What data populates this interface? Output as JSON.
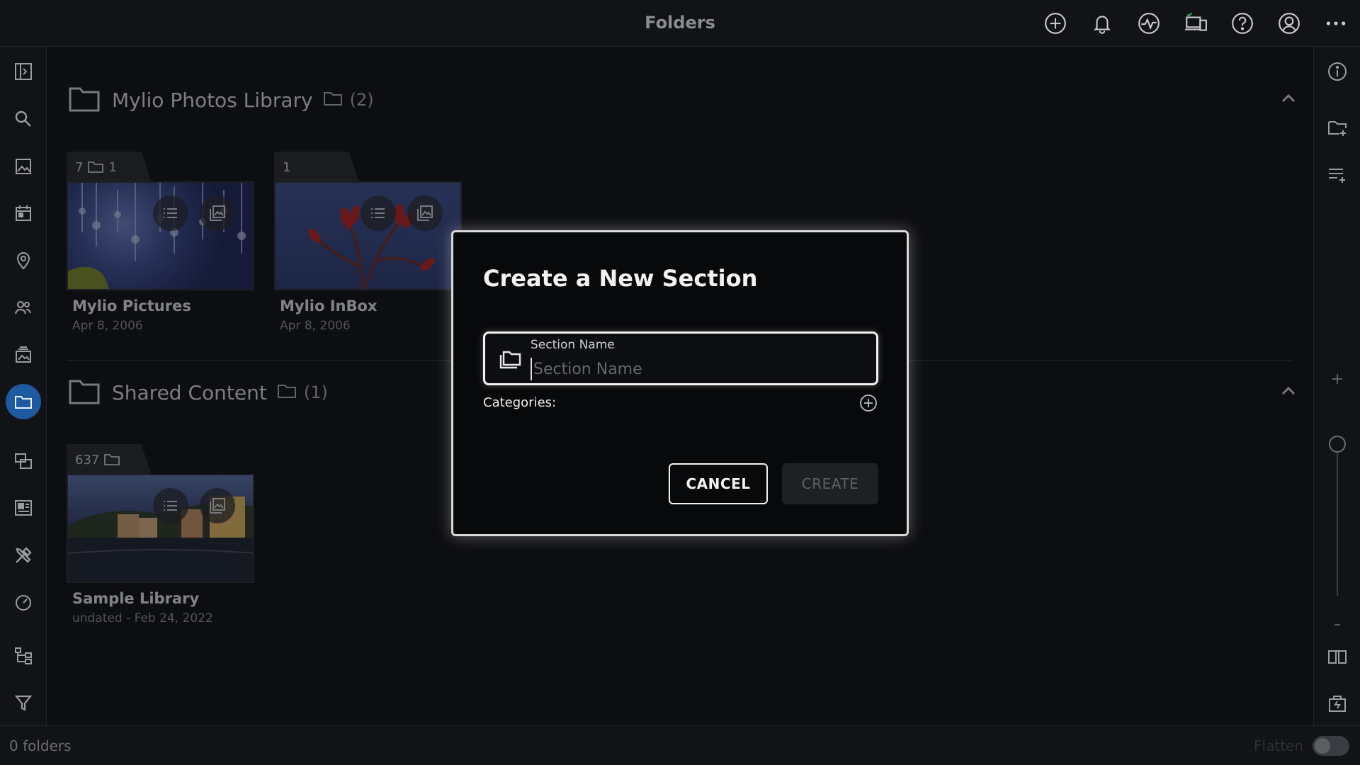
{
  "header": {
    "title": "Folders"
  },
  "sections": [
    {
      "name": "Mylio Photos Library",
      "count": "(2)"
    },
    {
      "name": "Shared Content",
      "count": "(1)"
    }
  ],
  "cards": [
    {
      "tab_primary": "7",
      "tab_secondary": "1",
      "name": "Mylio Pictures",
      "date": "Apr 8, 2006"
    },
    {
      "tab_primary": "1",
      "name": "Mylio InBox",
      "date": "Apr 8, 2006"
    },
    {
      "tab_primary": "637",
      "name": "Sample Library",
      "date": "undated - Feb 24, 2022"
    }
  ],
  "dialog": {
    "title": "Create a New Section",
    "field_label": "Section Name",
    "field_placeholder": "Section Name",
    "field_value": "",
    "categories_label": "Categories:",
    "cancel_label": "CANCEL",
    "create_label": "CREATE"
  },
  "footer": {
    "folder_count": "0 folders",
    "flatten_label": "Flatten"
  },
  "colors": {
    "accent": "#1d5aa0",
    "background": "#0d0e11",
    "dialog_border": "#d9d9d9"
  }
}
